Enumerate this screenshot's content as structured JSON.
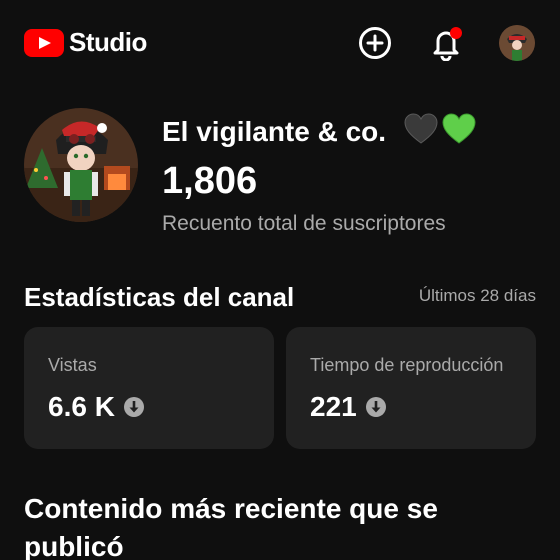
{
  "header": {
    "app_name": "Studio",
    "icons": {
      "logo": "youtube-play-icon",
      "create": "add-circle-icon",
      "notifications": "bell-icon",
      "account": "avatar"
    },
    "notification_dot_color": "#ff0000"
  },
  "channel": {
    "name": "El vigilante & co.",
    "hearts": [
      "🖤",
      "💚"
    ],
    "subscriber_count": "1,806",
    "subscriber_label": "Recuento total de suscriptores"
  },
  "stats": {
    "title": "Estadísticas del canal",
    "period": "Últimos 28 días",
    "cards": [
      {
        "label": "Vistas",
        "value": "6.6 K",
        "trend": "down"
      },
      {
        "label": "Tiempo de reproducción",
        "value": "221",
        "trend": "down"
      }
    ]
  },
  "recent": {
    "title": "Contenido más reciente que se publicó"
  },
  "colors": {
    "background": "#0f0f0f",
    "card": "#212121",
    "brand": "#ff0000",
    "secondary_text": "#aaaaaa"
  }
}
